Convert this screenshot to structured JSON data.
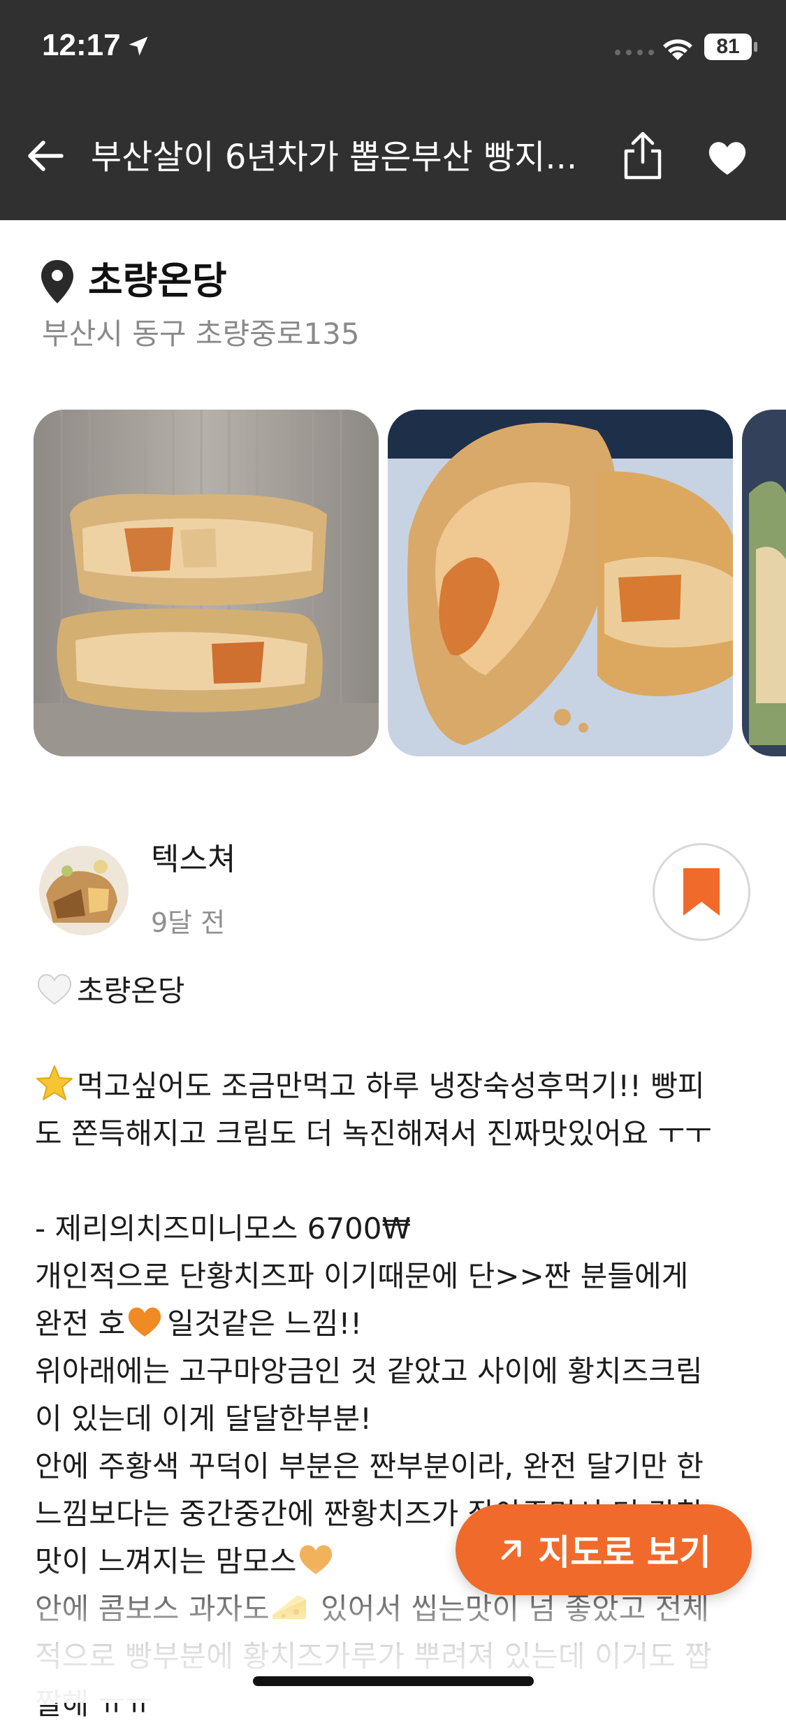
{
  "status_bar": {
    "time": "12:17",
    "battery": "81"
  },
  "header": {
    "title": "부산살이 6년차가 뽑은부산 빵지..."
  },
  "place": {
    "name": "초량온당",
    "address": "부산시 동구 초량중로135"
  },
  "photos": [
    {
      "icon": "photo-stacked-pastry"
    },
    {
      "icon": "photo-pastry-closeup"
    },
    {
      "icon": "photo-green-pastry-partial"
    }
  ],
  "post": {
    "author": "텍스쳐",
    "time_ago": "9달 전",
    "lines": [
      "초량온당",
      "",
      "먹고싶어도 조금만먹고 하루 냉장숙성후먹기!! 빵피",
      "도 쫀득해지고 크림도 더 녹진해져서 진짜맛있어요 ㅜㅜ",
      "",
      "- 제리의치즈미니모스 6700₩",
      "개인적으로 단황치즈파 이기때문에 단>>짠 분들에게",
      "완전 호",
      "일것같은 느낌!!",
      "위아래에는 고구마앙금인 것 같았고 사이에 황치즈크림",
      "이 있는데 이게 달달한부분!",
      "안에 주황색 꾸덕이 부분은 짠부분이라, 완전 달기만 한",
      "느낌보다는 중간중간에 짠황치즈가 잡아주면서 더 감칠",
      "맛이 느껴지는 맘모스",
      "안에 콤보스 과자도",
      " 있어서 씹는맛이 넘 좋았고 전체",
      "적으로 빵부분에 황치즈가루가 뿌려져 있는데 이거도 짭",
      "짤해 ㅠㅠ"
    ]
  },
  "map_button": {
    "label": "지도로 보기"
  },
  "colors": {
    "header_bg": "#303030",
    "accent": "#f06a2c",
    "address_gray": "#8a8a8a"
  }
}
